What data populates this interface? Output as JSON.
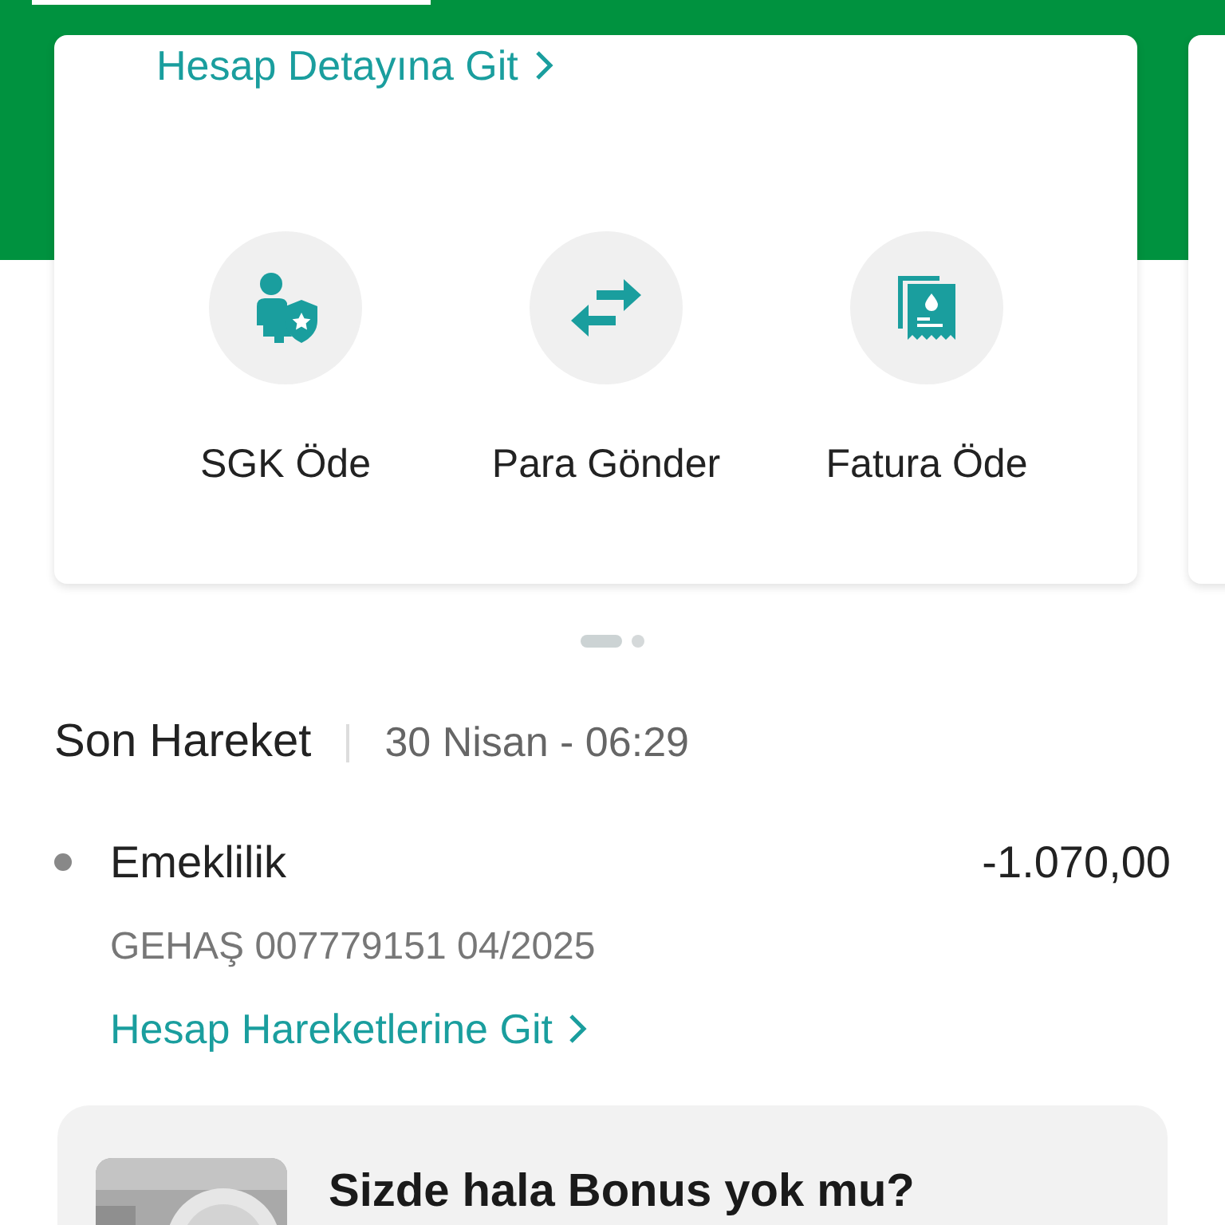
{
  "account_card": {
    "detail_link": "Hesap Detayına Git"
  },
  "quick_actions": [
    {
      "kind": "sgk",
      "label": "SGK Öde"
    },
    {
      "kind": "transfer",
      "label": "Para Gönder"
    },
    {
      "kind": "bill",
      "label": "Fatura Öde"
    }
  ],
  "page_dots": [
    {
      "selected": true
    },
    {
      "selected": false
    }
  ],
  "last_transaction": {
    "title": "Son Hareket",
    "date": "30 Nisan - 06:29",
    "name": "Emeklilik",
    "amount": "-1.070,00",
    "description": "GEHAŞ 007779151 04/2025",
    "link": "Hesap Hareketlerine Git"
  },
  "promo": {
    "title": "Sizde hala Bonus yok mu?"
  }
}
